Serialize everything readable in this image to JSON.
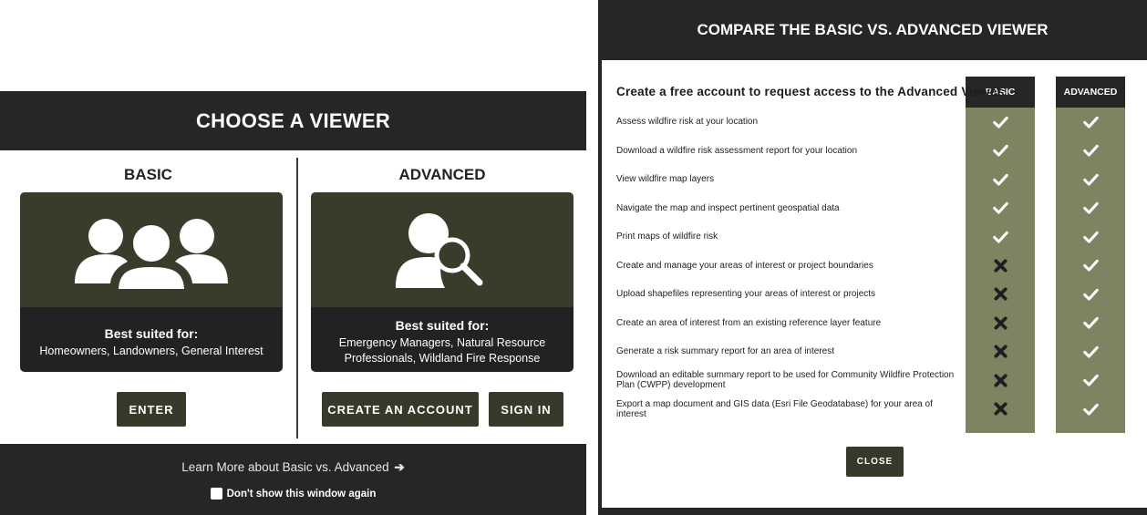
{
  "colors": {
    "dark": "#262626",
    "olive_dark": "#383d2b",
    "olive": "#7d8462",
    "button": "#363a2a"
  },
  "viewer": {
    "title": "CHOOSE A VIEWER",
    "basic": {
      "title": "BASIC",
      "icon": "users-group-icon",
      "suited_label": "Best suited for:",
      "suited_text": "Homeowners, Landowners, General Interest",
      "enter_label": "ENTER"
    },
    "advanced": {
      "title": "ADVANCED",
      "icon": "user-search-icon",
      "suited_label": "Best suited for:",
      "suited_text": "Emergency Managers, Natural Resource Professionals, Wildland Fire Response",
      "create_label": "CREATE AN ACCOUNT",
      "signin_label": "SIGN IN"
    },
    "learn_more": "Learn More about Basic vs. Advanced",
    "learn_more_icon": "arrow-right-icon",
    "dont_show": "Don't show this window again"
  },
  "compare": {
    "title": "COMPARE THE BASIC VS. ADVANCED VIEWER",
    "table_title": "Create a free account to request access to the Advanced Viewer.",
    "col_basic": "BASIC",
    "col_advanced": "ADVANCED",
    "rows": [
      {
        "label": "Assess wildfire risk at your location",
        "basic": "check",
        "advanced": "check"
      },
      {
        "label": "Download a wildfire risk assessment report for your location",
        "basic": "check",
        "advanced": "check"
      },
      {
        "label": "View wildfire map layers",
        "basic": "check",
        "advanced": "check"
      },
      {
        "label": "Navigate the map and inspect pertinent geospatial data",
        "basic": "check",
        "advanced": "check"
      },
      {
        "label": "Print maps of wildfire risk",
        "basic": "check",
        "advanced": "check"
      },
      {
        "label": "Create and manage your areas of interest or project boundaries",
        "basic": "cross",
        "advanced": "check"
      },
      {
        "label": "Upload shapefiles representing your areas of interest or projects",
        "basic": "cross",
        "advanced": "check"
      },
      {
        "label": "Create an area of interest from an existing reference layer feature",
        "basic": "cross",
        "advanced": "check"
      },
      {
        "label": "Generate a risk summary report for an area of interest",
        "basic": "cross",
        "advanced": "check"
      },
      {
        "label": "Download an editable summary report to be used for Community Wildfire Protection Plan (CWPP) development",
        "basic": "cross",
        "advanced": "check"
      },
      {
        "label": "Export a map document and GIS data (Esri File Geodatabase) for your area of interest",
        "basic": "cross",
        "advanced": "check"
      }
    ],
    "close_label": "CLOSE"
  }
}
